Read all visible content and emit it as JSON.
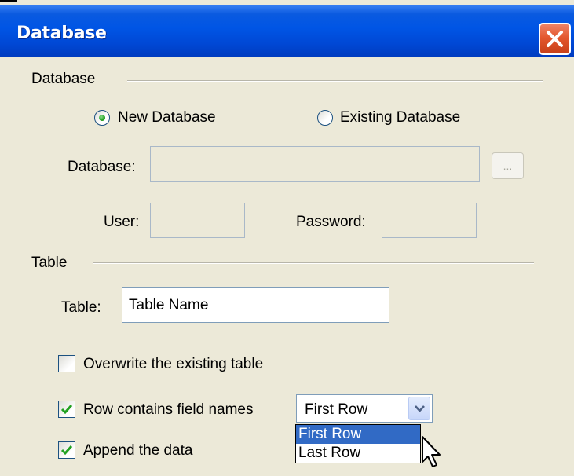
{
  "window": {
    "title": "Database"
  },
  "groups": {
    "database": "Database",
    "table": "Table"
  },
  "radios": [
    {
      "label": "New Database",
      "checked": true
    },
    {
      "label": "Existing Database",
      "checked": false
    }
  ],
  "fields": {
    "database_label": "Database:",
    "database_value": "",
    "browse_label": "...",
    "user_label": "User:",
    "user_value": "",
    "password_label": "Password:",
    "password_value": "",
    "table_label": "Table:",
    "table_value": "Table Name"
  },
  "checkboxes": [
    {
      "label": "Overwrite the existing table",
      "checked": false
    },
    {
      "label": "Row contains field names",
      "checked": true
    },
    {
      "label": "Append the data",
      "checked": true
    }
  ],
  "row_select": {
    "selected": "First Row",
    "options": [
      "First Row",
      "Last Row"
    ],
    "highlighted": "First Row"
  },
  "colors": {
    "titlebar": "#0055e5",
    "close": "#e4572e",
    "dialog_bg": "#ece9d8",
    "highlight": "#316ac5",
    "radio_dot": "#21a121"
  }
}
